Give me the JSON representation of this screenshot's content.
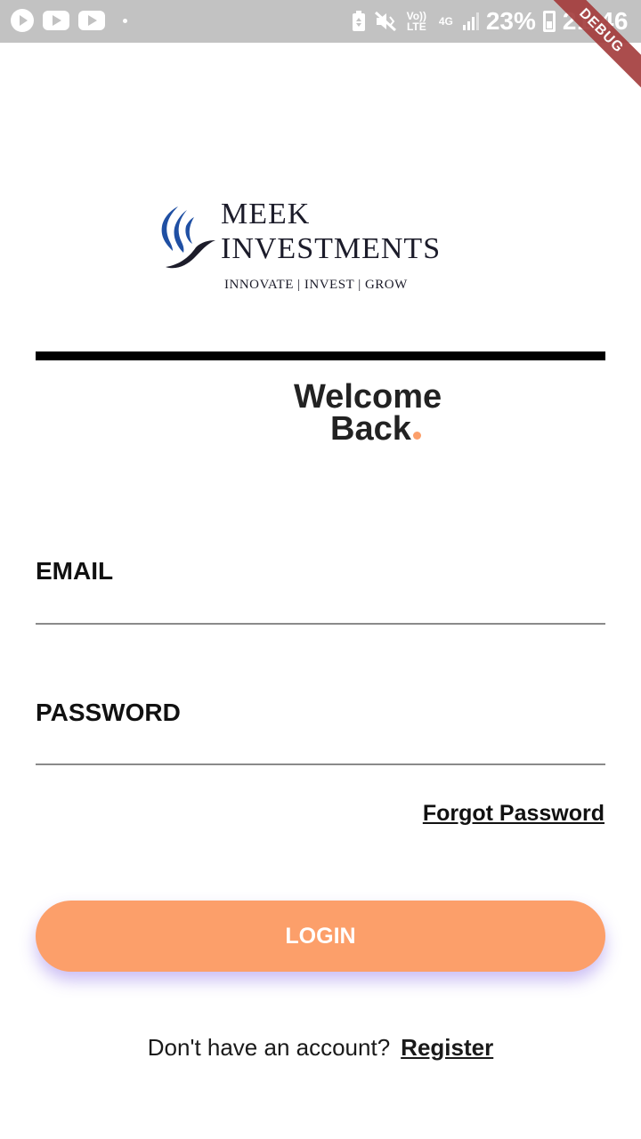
{
  "status_bar": {
    "volte": "Vo)) LTE",
    "network": "4G",
    "battery_percent": "23%",
    "time": "21:46",
    "icons": [
      "play-circle-icon",
      "youtube-icon",
      "youtube-icon",
      "dot-icon",
      "battery-saver-icon",
      "mute-vibrate-icon",
      "signal-icon",
      "battery-icon"
    ]
  },
  "debug_banner": "DEBUG",
  "logo": {
    "name_line1": "MEEK",
    "name_line2": "INVESTMENTS",
    "tagline": "INNOVATE | INVEST | GROW",
    "colors": {
      "blue": "#1f4fa3",
      "dark": "#1c1c2a"
    }
  },
  "welcome": {
    "line1": "Welcome",
    "line2": "Back",
    "dot_color": "#fc9f6a"
  },
  "form": {
    "email_label": "EMAIL",
    "email_value": "",
    "password_label": "PASSWORD",
    "password_value": "",
    "forgot_password": "Forgot Password",
    "login_label": "LOGIN"
  },
  "footer": {
    "prompt": "Don't have an account?",
    "register_label": "Register"
  },
  "colors": {
    "accent": "#fc9f6a",
    "status_bar": "#c2c2c2"
  }
}
